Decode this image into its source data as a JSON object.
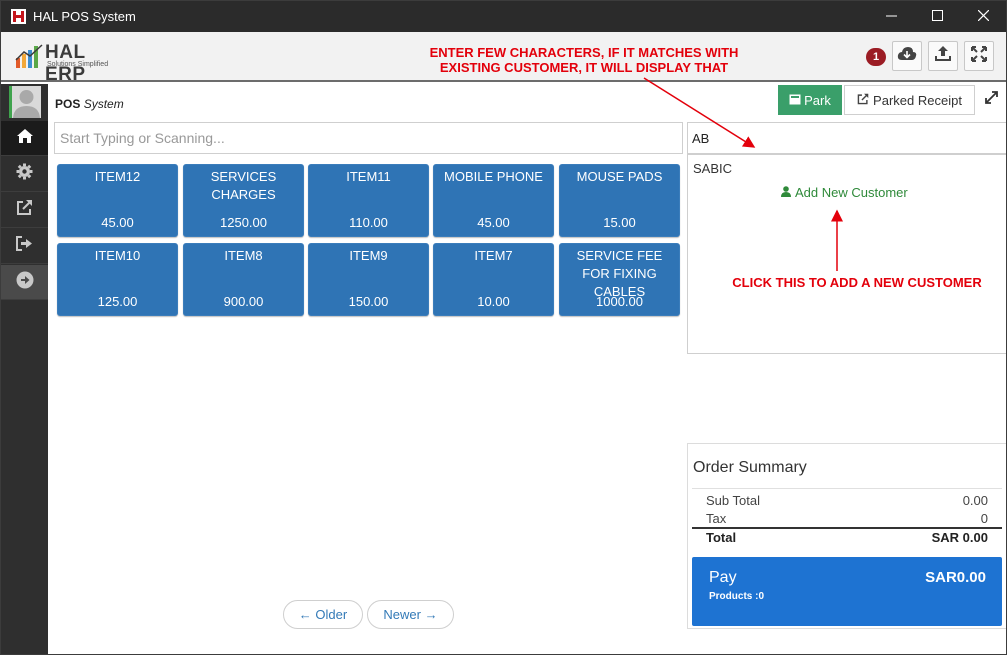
{
  "window": {
    "title": "HAL POS System",
    "controls": {
      "minimize": "minimize-icon",
      "maximize": "maximize-icon",
      "close": "close-icon"
    }
  },
  "header": {
    "brand_name": "HAL ERP",
    "brand_tagline": "Solutions Simplified",
    "notification_count": "1",
    "icons": [
      "cloud-download-icon",
      "upload-icon",
      "fullscreen-icon"
    ]
  },
  "annotations": {
    "top_line1": "ENTER FEW CHARACTERS, IF IT MATCHES WITH",
    "top_line2": "EXISTING CUSTOMER, IT WILL DISPLAY THAT",
    "bottom": "CLICK THIS TO ADD A NEW CUSTOMER"
  },
  "sidebar": {
    "items": [
      {
        "icon": "home-icon",
        "active": true
      },
      {
        "icon": "gear-icon",
        "active": false
      },
      {
        "icon": "external-link-icon",
        "active": false
      },
      {
        "icon": "sign-out-icon",
        "active": false
      },
      {
        "icon": "arrow-right-circle-icon",
        "active": false
      }
    ]
  },
  "pos": {
    "title_bold": "POS",
    "title_italic": "System",
    "park_label": "Park",
    "parked_receipt_label": "Parked Receipt",
    "search_placeholder": "Start Typing or Scanning...",
    "customer_value": "AB"
  },
  "products": [
    {
      "name": "ITEM12",
      "price": "45.00"
    },
    {
      "name": "SERVICES CHARGES",
      "price": "1250.00"
    },
    {
      "name": "ITEM11",
      "price": "110.00"
    },
    {
      "name": "MOBILE PHONE",
      "price": "45.00"
    },
    {
      "name": "MOUSE PADS",
      "price": "15.00"
    },
    {
      "name": "ITEM10",
      "price": "125.00"
    },
    {
      "name": "ITEM8",
      "price": "900.00"
    },
    {
      "name": "ITEM9",
      "price": "150.00"
    },
    {
      "name": "ITEM7",
      "price": "10.00"
    },
    {
      "name": "SERVICE FEE FOR FIXING CABLES",
      "price": "1000.00"
    }
  ],
  "customer_dropdown": {
    "match": "SABIC",
    "add_new_label": "Add New Customer"
  },
  "order_summary": {
    "title": "Order Summary",
    "subtotal_label": "Sub Total",
    "subtotal_value": "0.00",
    "tax_label": "Tax",
    "tax_value": "0",
    "total_label": "Total",
    "total_value": "SAR 0.00",
    "pay_label": "Pay",
    "pay_amount": "SAR0.00",
    "products_label": "Products :0"
  },
  "pagination": {
    "older": "← Older",
    "newer": "Newer →"
  },
  "colors": {
    "tile": "#2f74b5",
    "park": "#3a9f6a",
    "pay": "#1e73d2",
    "annotation": "#e3000b",
    "add_customer": "#2f8a3a"
  }
}
